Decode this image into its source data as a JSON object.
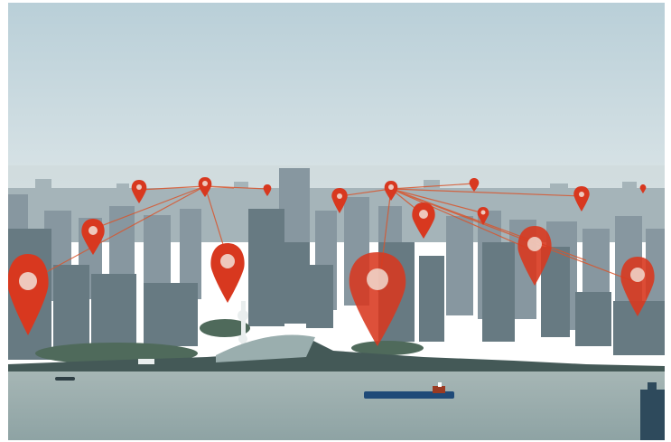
{
  "scene": {
    "sky_top": "#b9cfd8",
    "sky_bottom": "#dde6e8",
    "haze": "#cfdadc",
    "city_far": "#9fb0b6",
    "city_mid": "#7f919a",
    "city_near": "#5e6f78",
    "river": "#8ea3a4",
    "river_far": "#a6b6b5",
    "shore": "#3f5452",
    "pin_color": "#d8381f",
    "pin_hole": "#f2e2d8",
    "line_color": "#d8562e",
    "ship_hull": "#1f4a78",
    "ship_deck": "#9a3a22"
  },
  "pins": [
    {
      "size": "huge",
      "label": ""
    },
    {
      "size": "large",
      "label": ""
    },
    {
      "size": "huge",
      "label": ""
    },
    {
      "size": "large",
      "label": ""
    },
    {
      "size": "large",
      "label": ""
    }
  ]
}
